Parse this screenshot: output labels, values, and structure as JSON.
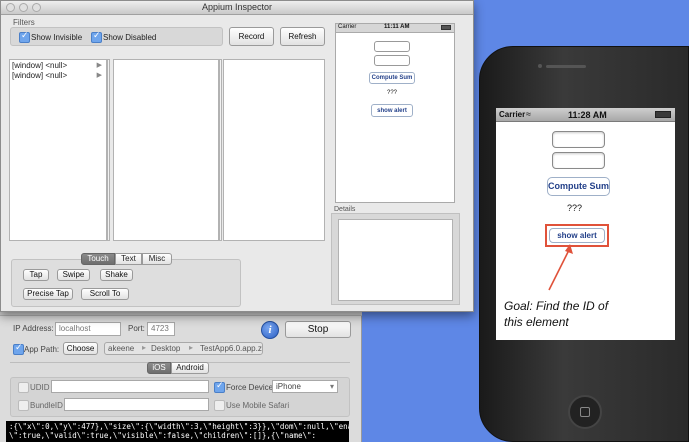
{
  "inspector": {
    "title": "Appium Inspector",
    "filters": {
      "heading": "Filters",
      "show_invisible": "Show Invisible",
      "show_disabled": "Show Disabled"
    },
    "record_label": "Record",
    "refresh_label": "Refresh",
    "tree": {
      "rows": [
        "[window] <null>",
        "[window] <null>"
      ]
    },
    "details_label": "Details",
    "action_tabs": [
      "Touch",
      "Text",
      "Misc"
    ],
    "actions": {
      "tap": "Tap",
      "swipe": "Swipe",
      "shake": "Shake",
      "precise_tap": "Precise Tap",
      "scroll_to": "Scroll To"
    },
    "preview": {
      "carrier": "Carrier",
      "time": "11:11 AM",
      "compute_sum": "Compute Sum",
      "result": "???",
      "show_alert": "show alert"
    }
  },
  "appium": {
    "ip_label": "IP Address:",
    "ip_value": "localhost",
    "port_label": "Port:",
    "port_value": "4723",
    "info_icon": "i",
    "stop_label": "Stop",
    "app_path_label": "App Path:",
    "choose_label": "Choose",
    "path_crumbs": [
      "akeene",
      "Desktop",
      "TestApp6.0.app.zip"
    ],
    "platform_tabs": [
      "iOS",
      "Android"
    ],
    "udid_label": "UDID",
    "force_device_label": "Force Device",
    "device_value": "iPhone",
    "bundle_label": "BundleID",
    "mobile_safari_label": "Use Mobile Safari",
    "log_lines": [
      ":{\\\"x\\\":0,\\\"y\\\":477},\\\"size\\\":{\\\"width\\\":3,\\\"height\\\":3}},\\\"dom\\\":null,\\\"enabled",
      "\\\":true,\\\"valid\\\":true,\\\"visible\\\":false,\\\"children\\\":[]},{\\\"name\\\":"
    ]
  },
  "simulator": {
    "carrier": "Carrier",
    "time": "11:28 AM",
    "compute_sum": "Compute Sum",
    "result": "???",
    "show_alert": "show alert"
  },
  "annotation": {
    "text": "Goal: Find the ID of this element",
    "color": "#e0523a"
  }
}
